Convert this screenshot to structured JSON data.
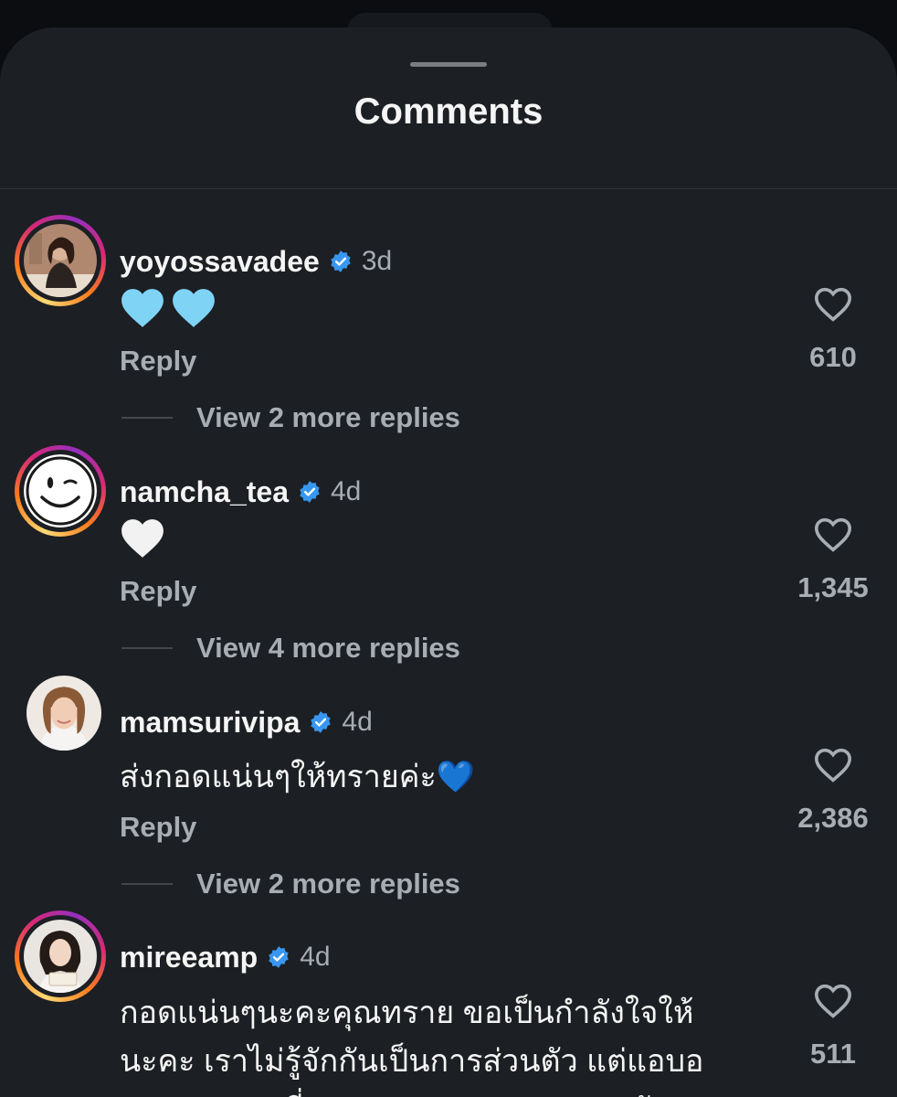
{
  "sheet": {
    "title": "Comments"
  },
  "comments": [
    {
      "username": "yoyossavadee",
      "verified": true,
      "time": "3d",
      "text": "💙💙",
      "reply_label": "Reply",
      "more_replies": "View 2 more replies",
      "likes": "610",
      "story_ring": true
    },
    {
      "username": "namcha_tea",
      "verified": true,
      "time": "4d",
      "text": "🤍",
      "reply_label": "Reply",
      "more_replies": "View 4 more replies",
      "likes": "1,345",
      "story_ring": true
    },
    {
      "username": "mamsurivipa",
      "verified": true,
      "time": "4d",
      "text": "ส่งกอดแน่นๆให้ทรายค่ะ💙",
      "reply_label": "Reply",
      "more_replies": "View 2 more replies",
      "likes": "2,386",
      "story_ring": false
    },
    {
      "username": "mireeamp",
      "verified": true,
      "time": "4d",
      "text_lines": [
        "กอดแน่นๆนะคะคุณทราย ขอเป็นกำลังใจให้",
        "นะคะ เราไม่รู้จักกันเป็นการส่วนตัว แต่แอบอ",
        "ยากขอบคุณที่คุณทรายดูแลทะเล ปะการัง"
      ],
      "likes": "511",
      "story_ring": true
    }
  ],
  "icons": {
    "verified": "verified-badge-icon",
    "like": "heart-outline-icon"
  },
  "colors": {
    "background": "#1c1f23",
    "verified_blue": "#3897f0",
    "secondary_text": "#a8adb3",
    "light_blue_heart": "#7fd3f5"
  }
}
